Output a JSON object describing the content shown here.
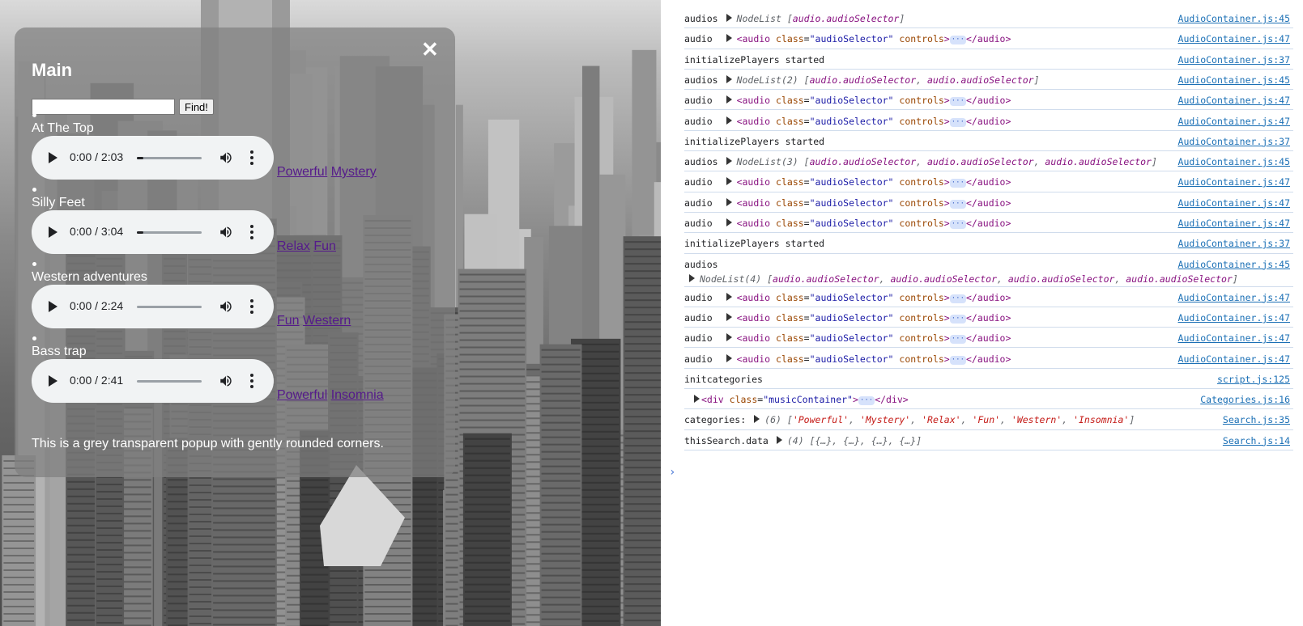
{
  "popup": {
    "close_label": "✕",
    "title": "Main",
    "search_value": "",
    "find_label": "Find!",
    "description": "This is a grey transparent popup with gently rounded corners.",
    "tracks": [
      {
        "title": "At The Top",
        "time": "0:00 / 2:03",
        "progress": 0.1,
        "tags": [
          "Powerful",
          "Mystery"
        ]
      },
      {
        "title": "Silly Feet",
        "time": "0:00 / 3:04",
        "progress": 0.08,
        "tags": [
          "Relax",
          "Fun"
        ]
      },
      {
        "title": "Western adventures",
        "time": "0:00 / 2:24",
        "progress": 0,
        "tags": [
          "Fun",
          "Western"
        ]
      },
      {
        "title": "Bass trap",
        "time": "0:00 / 2:41",
        "progress": 0,
        "tags": [
          "Powerful",
          "Insomnia"
        ]
      }
    ]
  },
  "console": {
    "rows": [
      {
        "kind": "nodelist",
        "label": "audios",
        "count": "",
        "items": [
          "audio.audioSelector"
        ],
        "source": "AudioContainer.js:45"
      },
      {
        "kind": "audio",
        "label": "audio",
        "source": "AudioContainer.js:47"
      },
      {
        "kind": "text",
        "label": "initializePlayers started",
        "source": "AudioContainer.js:37"
      },
      {
        "kind": "nodelist",
        "label": "audios",
        "count": "(2)",
        "items": [
          "audio.audioSelector",
          "audio.audioSelector"
        ],
        "source": "AudioContainer.js:45"
      },
      {
        "kind": "audio",
        "label": "audio",
        "source": "AudioContainer.js:47"
      },
      {
        "kind": "audio",
        "label": "audio",
        "source": "AudioContainer.js:47"
      },
      {
        "kind": "text",
        "label": "initializePlayers started",
        "source": "AudioContainer.js:37"
      },
      {
        "kind": "nodelist",
        "label": "audios",
        "count": "(3)",
        "items": [
          "audio.audioSelector",
          "audio.audioSelector",
          "audio.audioSelector"
        ],
        "source": "AudioContainer.js:45"
      },
      {
        "kind": "audio",
        "label": "audio",
        "source": "AudioContainer.js:47"
      },
      {
        "kind": "audio",
        "label": "audio",
        "source": "AudioContainer.js:47"
      },
      {
        "kind": "audio",
        "label": "audio",
        "source": "AudioContainer.js:47"
      },
      {
        "kind": "text",
        "label": "initializePlayers started",
        "source": "AudioContainer.js:37"
      },
      {
        "kind": "nodelist2",
        "label": "audios",
        "count": "(4)",
        "items": [
          "audio.audioSelector",
          "audio.audioSelector",
          "audio.audioSelector",
          "audio.audioSelector"
        ],
        "source": "AudioContainer.js:45"
      },
      {
        "kind": "audio",
        "label": "audio",
        "source": "AudioContainer.js:47"
      },
      {
        "kind": "audio",
        "label": "audio",
        "source": "AudioContainer.js:47"
      },
      {
        "kind": "audio",
        "label": "audio",
        "source": "AudioContainer.js:47"
      },
      {
        "kind": "audio",
        "label": "audio",
        "source": "AudioContainer.js:47"
      },
      {
        "kind": "text",
        "label": "initcategories",
        "source": "script.js:125"
      },
      {
        "kind": "div",
        "label": "",
        "source": "Categories.js:16"
      },
      {
        "kind": "array",
        "label": "categories:",
        "count": "(6)",
        "items": [
          "'Powerful'",
          "'Mystery'",
          "'Relax'",
          "'Fun'",
          "'Western'",
          "'Insomnia'"
        ],
        "source": "Search.js:35"
      },
      {
        "kind": "objects",
        "label": "thisSearch.data",
        "count": "(4)",
        "items": [
          "{…}",
          "{…}",
          "{…}",
          "{…}"
        ],
        "source": "Search.js:14"
      }
    ],
    "prompt": "›"
  },
  "strings": {
    "nodelist": "NodeList",
    "audio_tag_open": "<audio",
    "audio_attr_class": "class",
    "audio_class_value": "\"audioSelector\"",
    "audio_attr_controls": "controls",
    "audio_tag_close": "</audio>",
    "div_tag_open": "<div",
    "div_class_value": "\"musicContainer\"",
    "div_tag_close": "</div>",
    "ellipsis": "···"
  }
}
